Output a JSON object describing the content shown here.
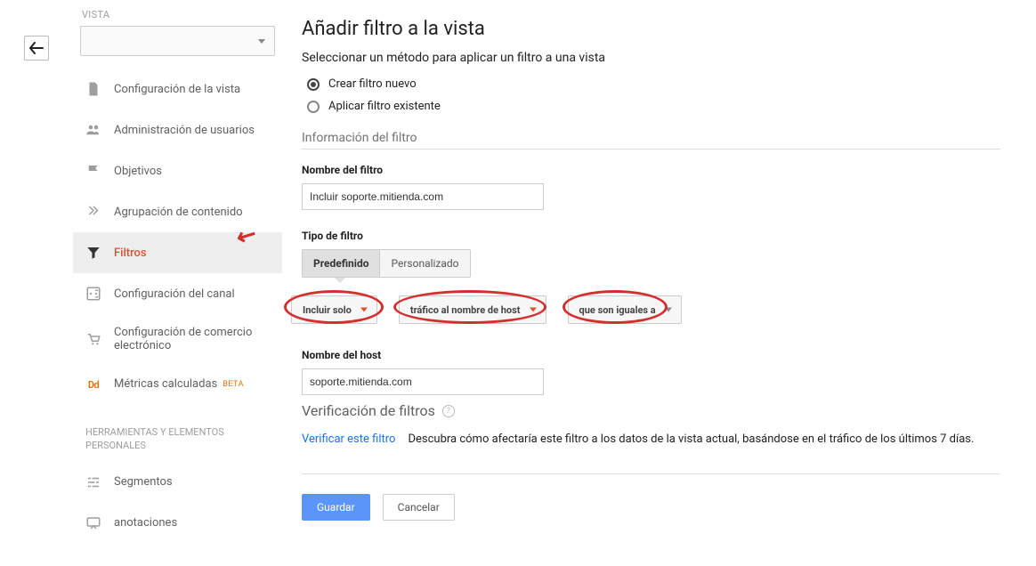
{
  "sidebar": {
    "section_label": "VISTA",
    "items": [
      {
        "label": "Configuración de la vista",
        "icon": "doc"
      },
      {
        "label": "Administración de usuarios",
        "icon": "users"
      },
      {
        "label": "Objetivos",
        "icon": "flag"
      },
      {
        "label": "Agrupación de contenido",
        "icon": "group"
      },
      {
        "label": "Filtros",
        "icon": "filter",
        "active": true
      },
      {
        "label": "Configuración del canal",
        "icon": "channel"
      },
      {
        "label": "Configuración de comercio electrónico",
        "icon": "cart"
      },
      {
        "label": "Métricas calculadas",
        "icon": "dd",
        "beta": "BETA"
      }
    ],
    "personal_heading": "HERRAMIENTAS Y ELEMENTOS PERSONALES",
    "personal_items": [
      {
        "label": "Segmentos",
        "icon": "segments"
      },
      {
        "label": "anotaciones",
        "icon": "annot"
      }
    ]
  },
  "main": {
    "title": "Añadir filtro a la vista",
    "method_heading": "Seleccionar un método para aplicar un filtro a una vista",
    "radios": {
      "create": "Crear filtro nuevo",
      "apply_existing": "Aplicar filtro existente"
    },
    "info_heading": "Información del filtro",
    "name_label": "Nombre del filtro",
    "name_value": "Incluir soporte.mitienda.com",
    "type_label": "Tipo de filtro",
    "tabs": {
      "predefined": "Predefinido",
      "custom": "Personalizado"
    },
    "dd1": "Incluir solo",
    "dd2": "tráfico al nombre de host",
    "dd3": "que son iguales a",
    "host_label": "Nombre del host",
    "host_value": "soporte.mitienda.com",
    "verify_heading": "Verificación de filtros",
    "verify_link": "Verificar este filtro",
    "verify_desc": "Descubra cómo afectaría este filtro a los datos de la vista actual, basándose en el tráfico de los últimos 7 días.",
    "save": "Guardar",
    "cancel": "Cancelar"
  }
}
